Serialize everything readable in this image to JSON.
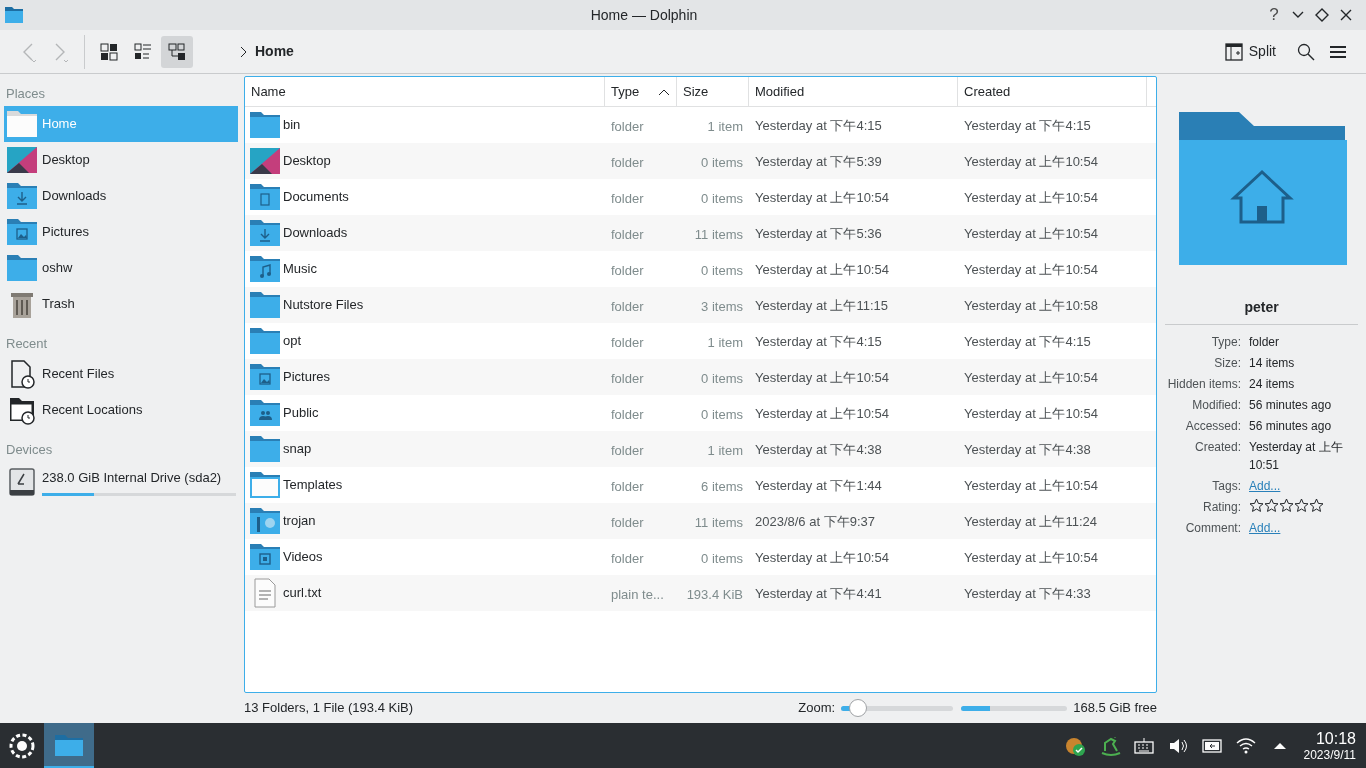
{
  "window": {
    "title": "Home — Dolphin"
  },
  "titlebar_buttons": [
    {
      "kind": "help",
      "label": "?"
    },
    {
      "kind": "minimize"
    },
    {
      "kind": "maximize"
    },
    {
      "kind": "close"
    }
  ],
  "toolbar": {
    "view_modes": [
      {
        "kind": "icons",
        "selected": false
      },
      {
        "kind": "compact",
        "selected": false
      },
      {
        "kind": "details",
        "selected": true
      }
    ],
    "breadcrumb": "Home",
    "split": "Split"
  },
  "sidebar": {
    "sections": [
      {
        "title": "Places",
        "items": [
          {
            "label": "Home",
            "kind": "home",
            "selected": true
          },
          {
            "label": "Desktop",
            "kind": "desktop",
            "selected": false
          },
          {
            "label": "Downloads",
            "kind": "downloads",
            "selected": false
          },
          {
            "label": "Pictures",
            "kind": "pictures",
            "selected": false
          },
          {
            "label": "oshw",
            "kind": "folder",
            "selected": false
          },
          {
            "label": "Trash",
            "kind": "trash",
            "selected": false
          }
        ]
      },
      {
        "title": "Recent",
        "items": [
          {
            "label": "Recent Files",
            "kind": "recent-files",
            "selected": false
          },
          {
            "label": "Recent Locations",
            "kind": "recent-locations",
            "selected": false
          }
        ]
      },
      {
        "title": "Devices",
        "items": [
          {
            "label": "238.0 GiB Internal Drive (sda2)",
            "kind": "drive",
            "selected": false,
            "level": 0.27
          }
        ]
      }
    ]
  },
  "table": {
    "columns": [
      {
        "label": "Name",
        "sorted": false
      },
      {
        "label": "Type",
        "sorted": true
      },
      {
        "label": "Size",
        "sorted": false
      },
      {
        "label": "Modified",
        "sorted": false
      },
      {
        "label": "Created",
        "sorted": false
      }
    ],
    "rows": [
      {
        "name": "bin",
        "kind": "folder",
        "type": "folder",
        "size": "1 item",
        "modified": "Yesterday at 下午4:15",
        "created": "Yesterday at 下午4:15"
      },
      {
        "name": "Desktop",
        "kind": "desktop",
        "type": "folder",
        "size": "0 items",
        "modified": "Yesterday at 下午5:39",
        "created": "Yesterday at 上午10:54"
      },
      {
        "name": "Documents",
        "kind": "documents",
        "type": "folder",
        "size": "0 items",
        "modified": "Yesterday at 上午10:54",
        "created": "Yesterday at 上午10:54"
      },
      {
        "name": "Downloads",
        "kind": "downloads",
        "type": "folder",
        "size": "11 items",
        "modified": "Yesterday at 下午5:36",
        "created": "Yesterday at 上午10:54"
      },
      {
        "name": "Music",
        "kind": "music",
        "type": "folder",
        "size": "0 items",
        "modified": "Yesterday at 上午10:54",
        "created": "Yesterday at 上午10:54"
      },
      {
        "name": "Nutstore Files",
        "kind": "folder",
        "type": "folder",
        "size": "3 items",
        "modified": "Yesterday at 上午11:15",
        "created": "Yesterday at 上午10:58"
      },
      {
        "name": "opt",
        "kind": "folder",
        "type": "folder",
        "size": "1 item",
        "modified": "Yesterday at 下午4:15",
        "created": "Yesterday at 下午4:15"
      },
      {
        "name": "Pictures",
        "kind": "pictures",
        "type": "folder",
        "size": "0 items",
        "modified": "Yesterday at 上午10:54",
        "created": "Yesterday at 上午10:54"
      },
      {
        "name": "Public",
        "kind": "public",
        "type": "folder",
        "size": "0 items",
        "modified": "Yesterday at 上午10:54",
        "created": "Yesterday at 上午10:54"
      },
      {
        "name": "snap",
        "kind": "folder",
        "type": "folder",
        "size": "1 item",
        "modified": "Yesterday at 下午4:38",
        "created": "Yesterday at 下午4:38"
      },
      {
        "name": "Templates",
        "kind": "templates",
        "type": "folder",
        "size": "6 items",
        "modified": "Yesterday at 下午1:44",
        "created": "Yesterday at 上午10:54"
      },
      {
        "name": "trojan",
        "kind": "trojan",
        "type": "folder",
        "size": "11 items",
        "modified": "2023/8/6 at 下午9:37",
        "created": "Yesterday at 上午11:24"
      },
      {
        "name": "Videos",
        "kind": "videos",
        "type": "folder",
        "size": "0 items",
        "modified": "Yesterday at 上午10:54",
        "created": "Yesterday at 上午10:54"
      },
      {
        "name": "curl.txt",
        "kind": "text",
        "type": "plain te...",
        "size": "193.4 KiB",
        "modified": "Yesterday at 下午4:41",
        "created": "Yesterday at 下午4:33"
      }
    ]
  },
  "info_panel": {
    "name": "peter",
    "fields": [
      {
        "label": "Type:",
        "value": "folder",
        "kind": "text"
      },
      {
        "label": "Size:",
        "value": "14 items",
        "kind": "text"
      },
      {
        "label": "Hidden items:",
        "value": "24 items",
        "kind": "text"
      },
      {
        "label": "Modified:",
        "value": "56 minutes ago",
        "kind": "text"
      },
      {
        "label": "Accessed:",
        "value": "56 minutes ago",
        "kind": "text"
      },
      {
        "label": "Created:",
        "value": "Yesterday at 上午 10:51",
        "kind": "text"
      },
      {
        "label": "Tags:",
        "value": "Add...",
        "kind": "link"
      },
      {
        "label": "Rating:",
        "kind": "rating",
        "stars": 0
      },
      {
        "label": "Comment:",
        "value": "Add...",
        "kind": "link"
      }
    ]
  },
  "status_bar": {
    "text": "13 Folders, 1 File (193.4 KiB)",
    "zoom_label": "Zoom:",
    "zoom": {
      "level": 0.15
    },
    "free_space": {
      "level": 0.27,
      "text": "168.5 GiB free"
    }
  },
  "taskbar": {
    "time": "10:18",
    "date": "2023/9/11"
  }
}
